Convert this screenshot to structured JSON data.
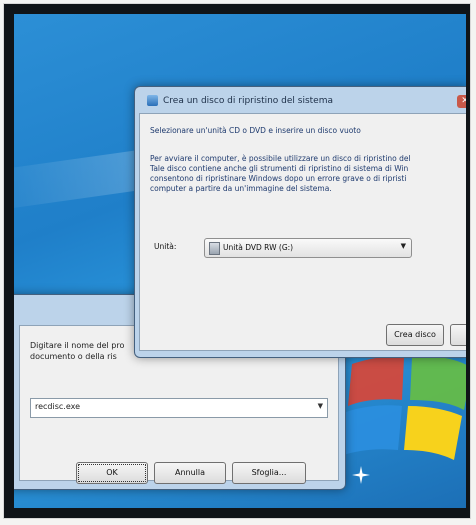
{
  "desktop": {
    "accent": "#1f7fc9"
  },
  "run_dialog": {
    "description_line1": "Digitare il nome del pro",
    "description_line2": "documento o della ris",
    "input_value": "recdisc.exe",
    "dropdown_icon": "chevron-down-icon",
    "buttons": {
      "ok": "OK",
      "cancel": "Annulla",
      "browse": "Sfoglia..."
    }
  },
  "repair_disc_dialog": {
    "title": "Crea un disco di ripristino del sistema",
    "instruction": "Selezionare un'unità CD o DVD e inserire un disco vuoto",
    "info_lines": [
      "Per avviare il computer, è possibile utilizzare un disco di ripristino del",
      "Tale disco contiene anche gli strumenti di ripristino di sistema di Win",
      "consentono di ripristinare Windows dopo un errore grave o di ripristi",
      "computer a partire da un'immagine del sistema."
    ],
    "drive_label": "Unità:",
    "drive_value": "Unità DVD RW (G:)",
    "create_button": "Crea disco"
  }
}
